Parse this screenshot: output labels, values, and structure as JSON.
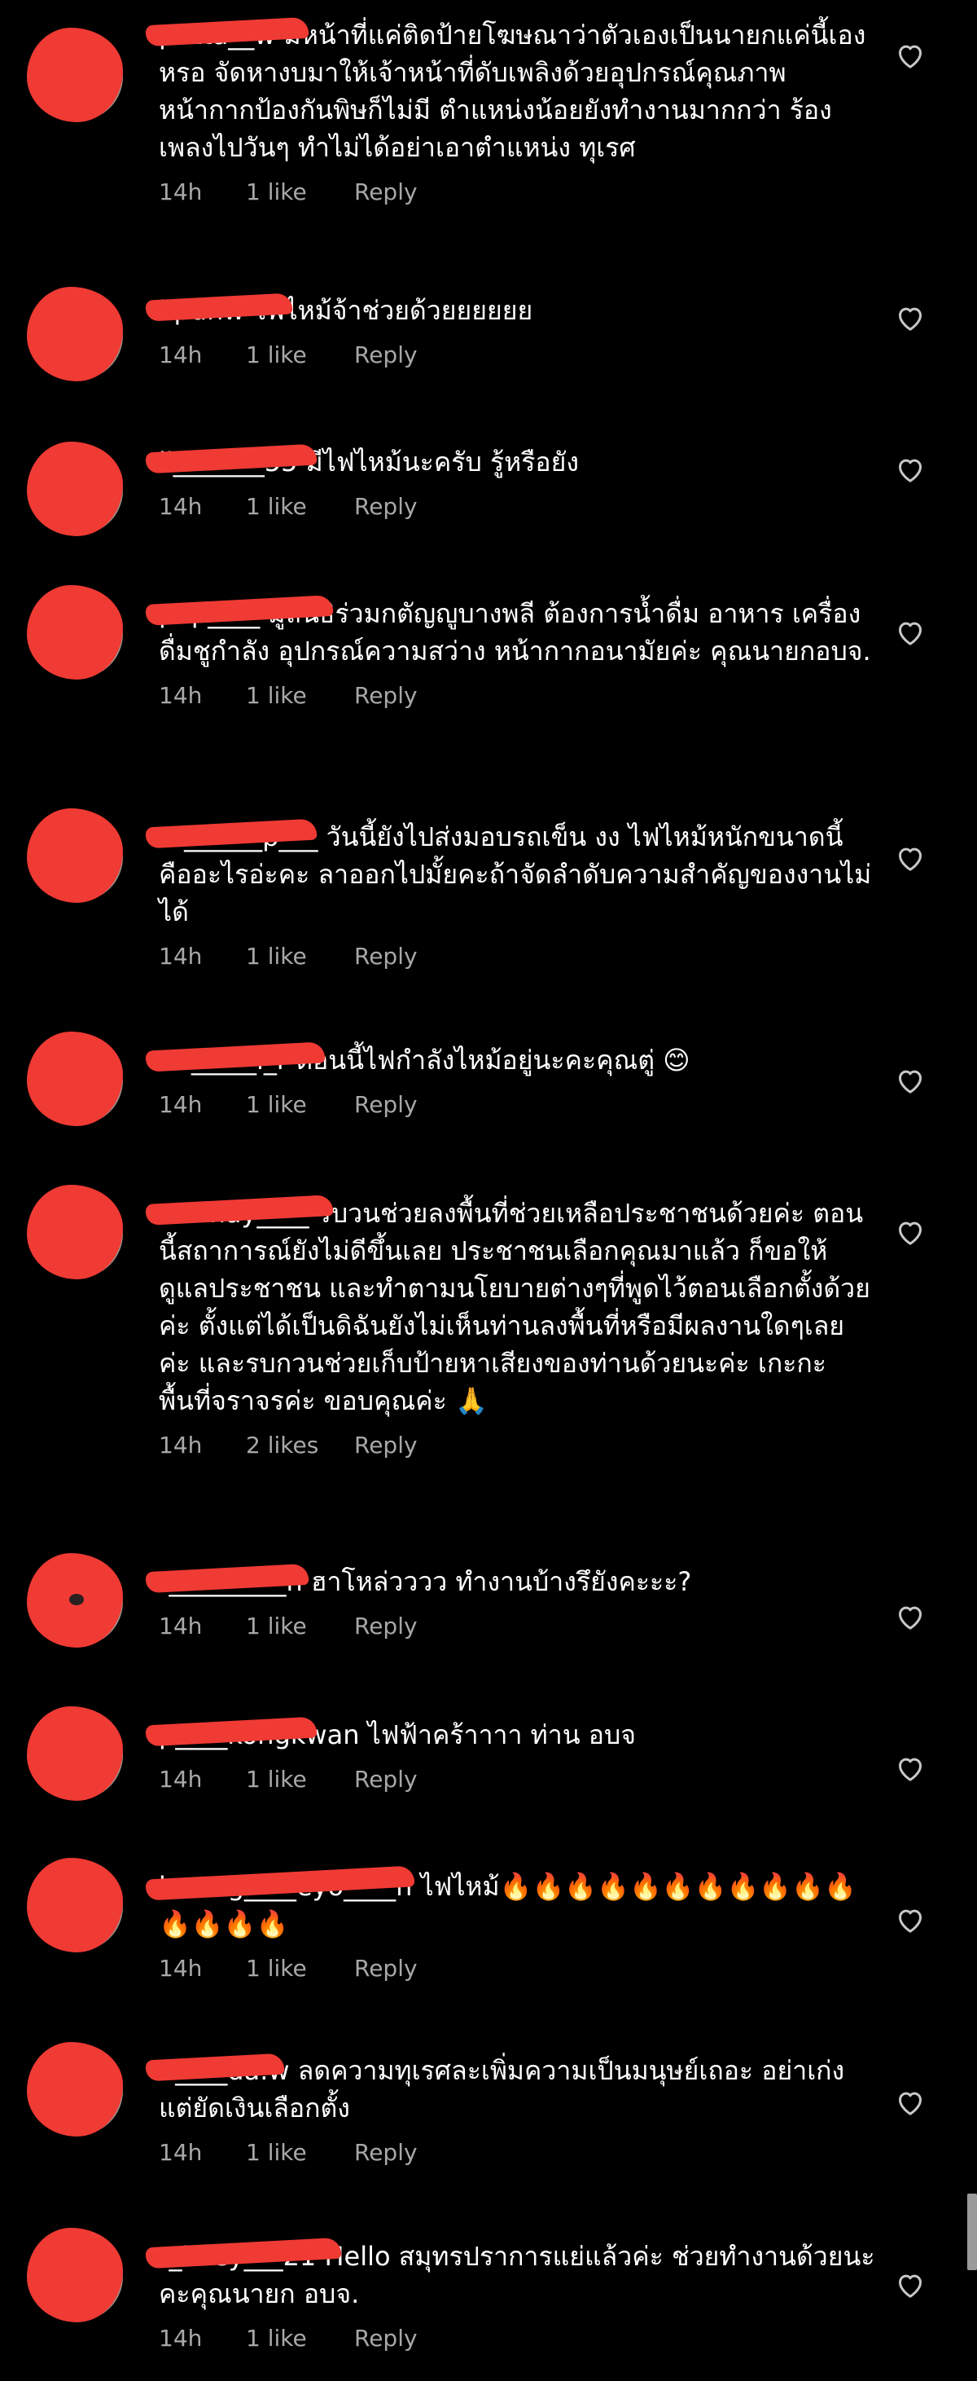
{
  "colors": {
    "background": "#000000",
    "text": "#ffffff",
    "meta": "#a8a8a8",
    "redaction": "#f03a34"
  },
  "comments": [
    {
      "username": "putta__w",
      "text": "มีหน้าที่แค่ติดป้ายโฆษณาว่าตัวเองเป็นนายกแค่นี้เองหรอ จัดหางบมาให้เจ้าหน้าที่ดับเพลิงด้วยอุปกรณ์คุณภาพ หน้ากากป้องกันพิษก็ไม่มี ตำแหน่งน้อยยังทำงานมากกว่า ร้องเพลงไปวันๆ ทำไม่ได้อย่าเอาตำแหน่ง ทุเรศ",
      "time": "14h",
      "likes": "1 like",
      "reply": "Reply",
      "like_icon": "heart-outline-icon"
    },
    {
      "username": "kpunw",
      "text": "ไฟไหม้จ้าช่วยด้วยยยยยย",
      "time": "14h",
      "likes": "1 like",
      "reply": "Reply",
      "like_icon": "heart-outline-icon"
    },
    {
      "username": "il_______55",
      "text": "มีไฟไหม้นะครับ รู้หรือยัง",
      "time": "14h",
      "likes": "1 like",
      "reply": "Reply",
      "like_icon": "heart-outline-icon"
    },
    {
      "username": "pop____",
      "text": "มูลนิธิร่วมกตัญญูบางพลี ต้องการน้ำดื่ม อาหาร เครื่องดื่มชูกำลัง อุปกรณ์ความสว่าง หน้ากากอนามัยค่ะ คุณนายกอบจ.",
      "time": "14h",
      "likes": "1 like",
      "reply": "Reply",
      "like_icon": "heart-outline-icon"
    },
    {
      "username": "m______p___",
      "text": "วันนี้ยังไปส่งมอบรถเข็น งง ไฟไหม้หนักขนาดนี้คืออะไรอ่ะคะ ลาออกไปมั้ยคะถ้าจัดลำดับความสำคัญของงานไม่ได้",
      "time": "14h",
      "likes": "1 like",
      "reply": "Reply",
      "like_icon": "heart-outline-icon"
    },
    {
      "username": "ne_____l_r",
      "text": "ตอนนี้ไฟกำลังไหม้อยู่นะคะคุณตู่ 😊",
      "time": "14h",
      "likes": "1 like",
      "reply": "Reply",
      "like_icon": "heart-outline-icon"
    },
    {
      "username": "momay____",
      "text": "รบวนช่วยลงพื้นที่ช่วยเหลือประชาชนด้วยค่ะ ตอนนี้สถาการณ์ยังไม่ดีขึ้นเลย ประชาชนเลือกคุณมาแล้ว ก็ขอให้ดูแลประชาชน และทำตามนโยบายต่างๆที่พูดไว้ตอนเลือกตั้งด้วยค่ะ ตั้งแต่ได้เป็นดิฉันยังไม่เห็นท่านลงพื้นที่หรือมีผลงานใดๆเลยค่ะ และรบกวนช่วยเก็บป้ายหาเสียงของท่านด้วยนะค่ะ เกะกะพื้นที่จราจรค่ะ ขอบคุณค่ะ 🙏",
      "time": "14h",
      "likes": "2 likes",
      "reply": "Reply",
      "like_icon": "heart-outline-icon"
    },
    {
      "username": "t_________n",
      "text": "ฮาโหล่วววว ทำงานบ้างรึยังคะะะ?",
      "time": "14h",
      "likes": "1 like",
      "reply": "Reply",
      "like_icon": "heart-outline-icon"
    },
    {
      "username": "p____kongkwan",
      "text": "ไฟฟ้าคร้าาาา ท่าน อบจ",
      "time": "14h",
      "likes": "1 like",
      "reply": "Reply",
      "like_icon": "heart-outline-icon"
    },
    {
      "username": "kwang____eyo____n",
      "text": "ไฟไหม้🔥🔥🔥🔥🔥🔥🔥🔥🔥🔥🔥🔥🔥🔥🔥",
      "time": "14h",
      "likes": "1 like",
      "reply": "Reply",
      "like_icon": "heart-outline-icon"
    },
    {
      "username": "n____da.w",
      "text": "ลดความทุเรศละเพิ่มความเป็นมนุษย์เถอะ อย่าเก่งแต่ยัดเงินเลือกตั้ง",
      "time": "14h",
      "likes": "1 like",
      "reply": "Reply",
      "like_icon": "heart-outline-icon"
    },
    {
      "username": "t_laley___21",
      "text": "Hello สมุทรปราการแย่แล้วค่ะ ช่วยทำงานด้วยนะคะคุณนายก อบจ.",
      "time": "14h",
      "likes": "1 like",
      "reply": "Reply",
      "like_icon": "heart-outline-icon"
    }
  ]
}
